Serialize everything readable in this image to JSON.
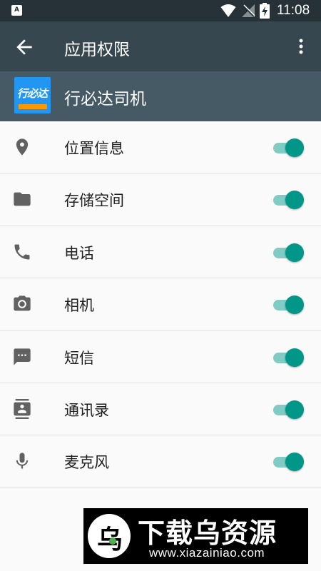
{
  "status_bar": {
    "notification_icon": "A",
    "time": "11:08",
    "icons": [
      "wifi-icon",
      "no-signal-icon",
      "battery-charging-icon"
    ]
  },
  "toolbar": {
    "title": "应用权限",
    "back_icon": "arrow-left-icon",
    "menu_icon": "more-vert-icon"
  },
  "app": {
    "name": "行必达司机",
    "icon_text": "行必达"
  },
  "permissions": [
    {
      "label": "位置信息",
      "icon": "location-icon",
      "enabled": true
    },
    {
      "label": "存储空间",
      "icon": "folder-icon",
      "enabled": true
    },
    {
      "label": "电话",
      "icon": "phone-icon",
      "enabled": true
    },
    {
      "label": "相机",
      "icon": "camera-icon",
      "enabled": true
    },
    {
      "label": "短信",
      "icon": "sms-icon",
      "enabled": true
    },
    {
      "label": "通讯录",
      "icon": "contacts-icon",
      "enabled": true
    },
    {
      "label": "麦克风",
      "icon": "microphone-icon",
      "enabled": true
    }
  ],
  "watermark": {
    "logo_char": "乌",
    "title": "下载乌资源",
    "url": "www.xiazainiao.com"
  },
  "colors": {
    "status_bar": "#263238",
    "toolbar": "#37474f",
    "app_header": "#455a64",
    "toggle_on": "#009688",
    "toggle_track": "#80cbc4",
    "icon": "#616161"
  }
}
